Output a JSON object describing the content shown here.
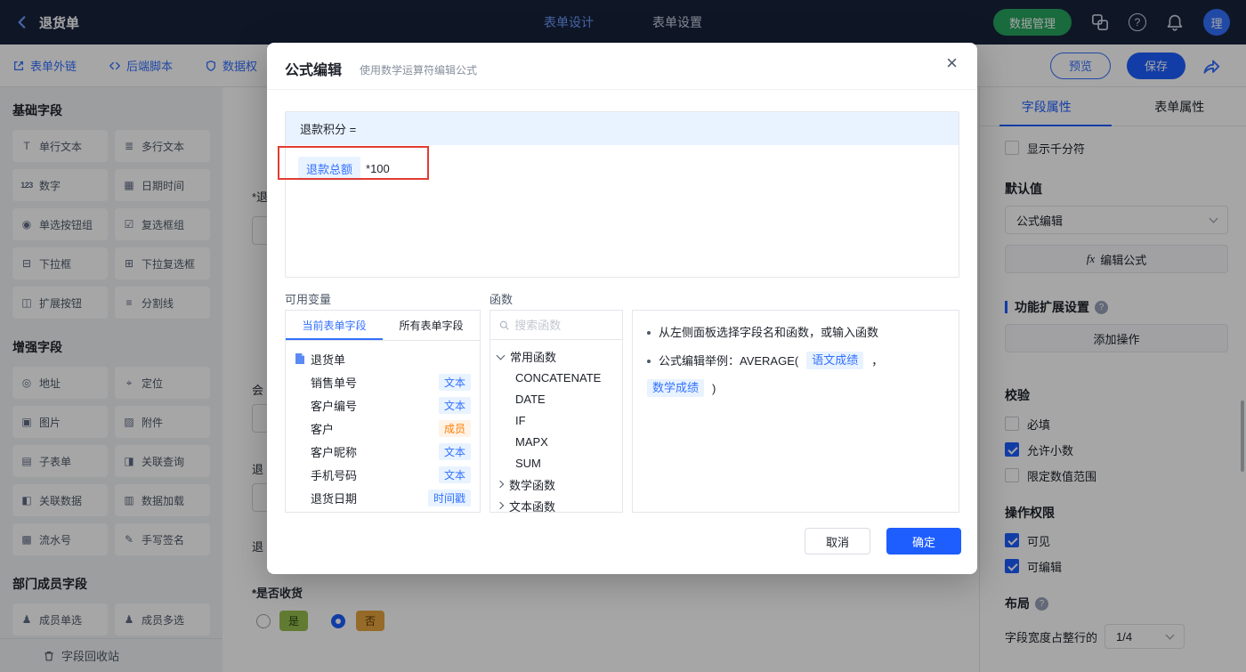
{
  "colors": {
    "accent": "#3370ff",
    "primary-btn": "#1e5eff",
    "header-bg": "#17243d",
    "green-btn": "#27a35f",
    "tag-orange": "#ff7d00",
    "tag-orange-bg": "#fff3e8",
    "tag-blue-bg": "#e8f3ff",
    "annotation-red": "#e23c32",
    "yes-bg": "#95bf4e",
    "yes-text": "#2c3f10",
    "no-bg": "#e7a33e",
    "no-text": "#5f3a06"
  },
  "icons": {
    "help": "?",
    "close": "×"
  },
  "header": {
    "back_title": "退货单",
    "nav_tabs": [
      {
        "label": "表单设计"
      },
      {
        "label": "表单设置"
      }
    ],
    "data_manage": "数据管理",
    "avatar": "理"
  },
  "toolbar": {
    "links": [
      {
        "label": "表单外链"
      },
      {
        "label": "后端脚本"
      },
      {
        "label": "数据权"
      }
    ],
    "preview": "预览",
    "save": "保存"
  },
  "sidebar": {
    "sections": [
      {
        "title": "基础字段",
        "fields": [
          {
            "label": "单行文本",
            "icon": "T"
          },
          {
            "label": "多行文本",
            "icon": "≣"
          },
          {
            "label": "数字",
            "icon": "123"
          },
          {
            "label": "日期时间",
            "icon": "▦"
          },
          {
            "label": "单选按钮组",
            "icon": "◉"
          },
          {
            "label": "复选框组",
            "icon": "☑"
          },
          {
            "label": "下拉框",
            "icon": "⊟"
          },
          {
            "label": "下拉复选框",
            "icon": "⊞"
          },
          {
            "label": "扩展按钮",
            "icon": "◫"
          },
          {
            "label": "分割线",
            "icon": "≡"
          }
        ]
      },
      {
        "title": "增强字段",
        "fields": [
          {
            "label": "地址",
            "icon": "◎"
          },
          {
            "label": "定位",
            "icon": "⌖"
          },
          {
            "label": "图片",
            "icon": "▣"
          },
          {
            "label": "附件",
            "icon": "▨"
          },
          {
            "label": "子表单",
            "icon": "▤"
          },
          {
            "label": "关联查询",
            "icon": "◨"
          },
          {
            "label": "关联数据",
            "icon": "◧"
          },
          {
            "label": "数据加载",
            "icon": "▥"
          },
          {
            "label": "流水号",
            "icon": "▩"
          },
          {
            "label": "手写签名",
            "icon": "✎"
          }
        ]
      },
      {
        "title": "部门成员字段",
        "fields": [
          {
            "label": "成员单选",
            "icon": "♟"
          },
          {
            "label": "成员多选",
            "icon": "♟"
          }
        ]
      }
    ],
    "recycle": "字段回收站"
  },
  "canvas": {
    "fragments": [
      "*退",
      "会",
      "退",
      "退"
    ],
    "receive": {
      "label": "*是否收货",
      "options": [
        {
          "tag": "是",
          "selected": false
        },
        {
          "tag": "否",
          "selected": true
        }
      ]
    }
  },
  "modal": {
    "title": "公式编辑",
    "subtitle": "使用数学运算符编辑公式",
    "formula": {
      "lhs": "退款积分 =",
      "field_ref": "退款总额",
      "rest": "*100"
    },
    "variables": {
      "label": "可用变量",
      "tabs": [
        {
          "label": "当前表单字段"
        },
        {
          "label": "所有表单字段"
        }
      ],
      "form": "退货单",
      "fields": [
        {
          "name": "销售单号",
          "type": "文本"
        },
        {
          "name": "客户编号",
          "type": "文本"
        },
        {
          "name": "客户",
          "type": "成员"
        },
        {
          "name": "客户昵称",
          "type": "文本"
        },
        {
          "name": "手机号码",
          "type": "文本"
        },
        {
          "name": "退货日期",
          "type": "时间戳"
        }
      ]
    },
    "functions": {
      "label": "函数",
      "search_placeholder": "搜索函数",
      "groups": [
        {
          "name": "常用函数"
        },
        {
          "name": "数学函数"
        },
        {
          "name": "文本函数"
        }
      ],
      "common_items": [
        "CONCATENATE",
        "DATE",
        "IF",
        "MAPX",
        "SUM"
      ]
    },
    "help": {
      "line1": "从左侧面板选择字段名和函数，或输入函数",
      "line2_prefix": "公式编辑举例：AVERAGE(",
      "example_tag1": "语文成绩",
      "separator": "，",
      "example_tag2": "数学成绩",
      "line2_suffix": ")"
    },
    "cancel": "取消",
    "confirm": "确定"
  },
  "panel": {
    "tabs": [
      {
        "label": "字段属性"
      },
      {
        "label": "表单属性"
      }
    ],
    "thousand": "显示千分符",
    "default_label": "默认值",
    "default_value": "公式编辑",
    "fx": "fx",
    "edit_formula": "编辑公式",
    "ext_title": "功能扩展设置",
    "add_action": "添加操作",
    "validate_title": "校验",
    "validations": [
      {
        "label": "必填",
        "checked": false
      },
      {
        "label": "允许小数",
        "checked": true
      },
      {
        "label": "限定数值范围",
        "checked": false
      }
    ],
    "perm_title": "操作权限",
    "permissions": [
      {
        "label": "可见",
        "checked": true
      },
      {
        "label": "可编辑",
        "checked": true
      }
    ],
    "layout_title": "布局",
    "width_label": "字段宽度占整行的",
    "width_value": "1/4"
  }
}
